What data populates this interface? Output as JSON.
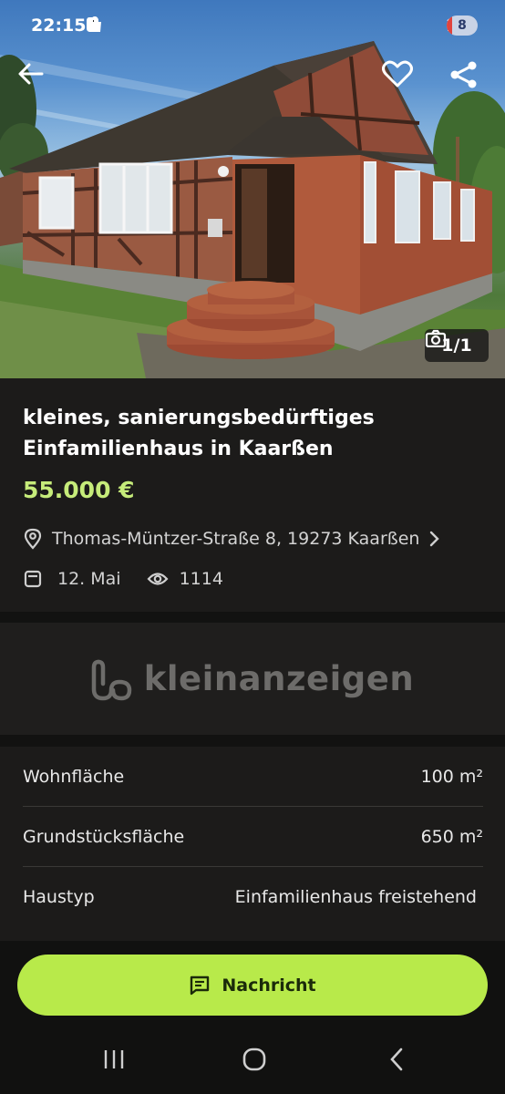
{
  "status_bar": {
    "time": "22:15",
    "left_icons": [
      "kleinanzeigen-icon",
      "alert-icon",
      "shopping-bag-icon",
      "dot-icon"
    ],
    "right_icons": [
      "wifi-icon",
      "signal-icon"
    ],
    "battery_level": "8"
  },
  "hero": {
    "photo_counter": "1/1",
    "image": "house-photo"
  },
  "listing": {
    "title": "kleines, sanierungsbedürftiges Einfamilienhaus in Kaarßen",
    "price": "55.000 €",
    "address": "Thomas-Müntzer-Straße 8, 19273 Kaarßen",
    "date": "12. Mai",
    "views": "1114"
  },
  "ad_banner": {
    "brand": "kleinanzeigen"
  },
  "details": [
    {
      "label": "Wohnfläche",
      "value": "100 m²"
    },
    {
      "label": "Grundstücksfläche",
      "value": "650 m²"
    },
    {
      "label": "Haustyp",
      "value": "Einfamilienhaus freistehend"
    }
  ],
  "actions": {
    "message_label": "Nachricht"
  },
  "colors": {
    "accent": "#b8ea4a",
    "price": "#c6ec7a",
    "background": "#1c1b1a"
  }
}
